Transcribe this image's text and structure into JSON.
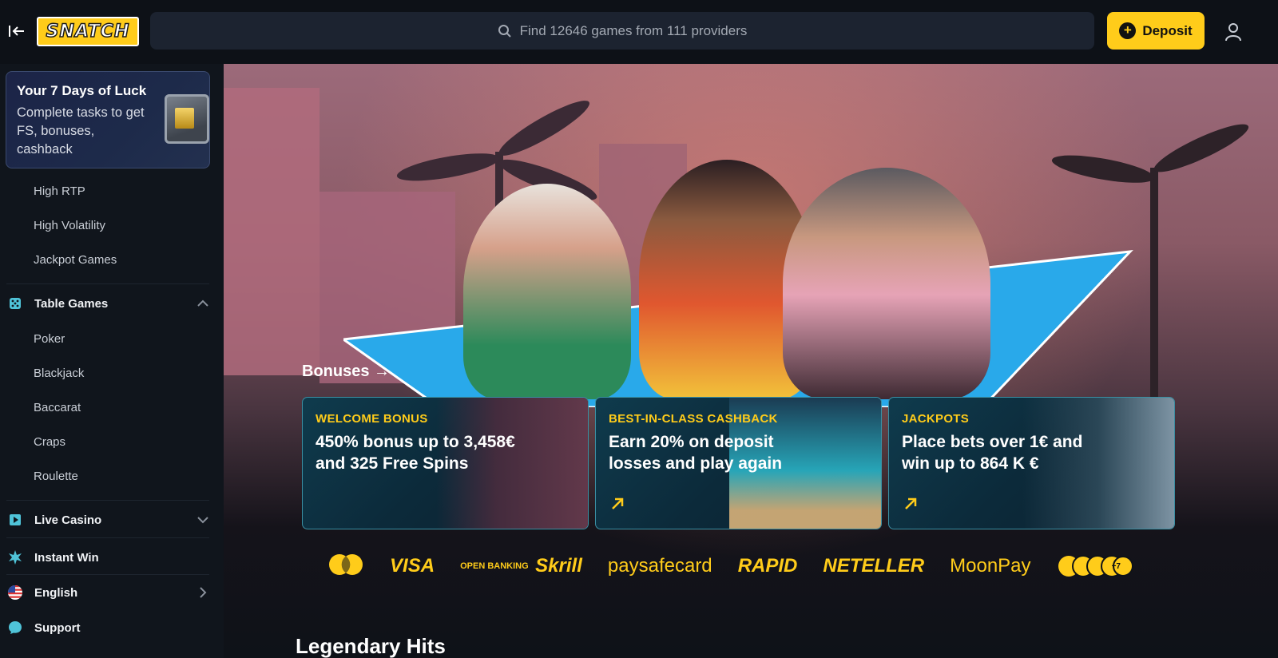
{
  "header": {
    "logo_text": "SNATCH",
    "search_placeholder": "Find 12646 games from 111 providers",
    "deposit_label": "Deposit"
  },
  "promo": {
    "title": "Your 7 Days of Luck",
    "text": "Complete tasks to get FS, bonuses, cashback"
  },
  "sidebar": {
    "sub_items_top": [
      "High RTP",
      "High Volatility",
      "Jackpot Games"
    ],
    "table_games": {
      "label": "Table Games",
      "items": [
        "Poker",
        "Blackjack",
        "Baccarat",
        "Craps",
        "Roulette"
      ]
    },
    "live_casino": "Live Casino",
    "instant_win": "Instant Win",
    "language": "English",
    "support": "Support"
  },
  "main": {
    "bonuses_link": "Bonuses",
    "cards": [
      {
        "title": "WELCOME BONUS",
        "body": "450% bonus up to 3,458€ and 325 Free Spins"
      },
      {
        "title": "BEST-IN-CLASS CASHBACK",
        "body": "Earn 20% on deposit losses and play again"
      },
      {
        "title": "JACKPOTS",
        "body": "Place bets over 1€ and win up to 864 K €"
      }
    ],
    "payments": [
      "VISA",
      "OPEN BANKING",
      "Skrill",
      "paysafecard",
      "RAPID",
      "NETELLER",
      "MoonPay",
      "+7"
    ],
    "section_title": "Legendary Hits"
  },
  "colors": {
    "accent": "#ffcc1a",
    "background": "#0f141b",
    "card_border": "#3a8fa3"
  }
}
